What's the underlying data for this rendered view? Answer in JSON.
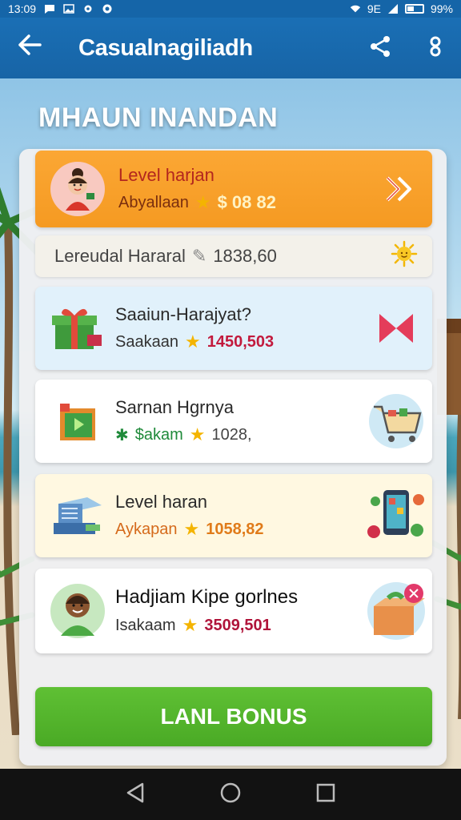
{
  "status_bar": {
    "time": "13:09",
    "network_label": "9E",
    "battery": "99%",
    "icons": [
      "message-icon",
      "image-icon",
      "settings-icon",
      "record-icon",
      "wifi-icon",
      "signal-icon",
      "battery-icon"
    ]
  },
  "app_bar": {
    "back_icon": "arrow-left-icon",
    "title": "Casualnagiliadh",
    "share_icon": "share-icon",
    "menu_icon": "more-icon"
  },
  "heading": "MHAUN INANDAN",
  "cards": {
    "top": {
      "title": "Level harjan",
      "subtitle": "Abyallaan",
      "amount": "$ 08 82",
      "avatar_icon": "girl-avatar-icon",
      "action_icon": "chevron-double-right-icon"
    },
    "info_row": {
      "label": "Lereudal Hararal",
      "amount": "1838,60",
      "badge_icon": "sun-icon"
    },
    "list": [
      {
        "title": "Saaiun-Harajyat?",
        "subtitle": "Saakaan",
        "amount": "1450,503",
        "left_icon": "gift-box-icon",
        "right_icon": "bowtie-icon"
      },
      {
        "title": "Sarnan Hgrnya",
        "subtitle": "$akam",
        "amount": "1028,",
        "left_icon": "green-box-icon",
        "right_icon": "shopping-cart-icon"
      },
      {
        "title": "Level haran",
        "subtitle": "Aykapan",
        "amount": "1058,82",
        "left_icon": "cash-register-icon",
        "right_icon": "phone-gifts-icon"
      },
      {
        "title": "Hadjiam Kipe gorlnes",
        "subtitle": "Isakaam",
        "amount": "3509,501",
        "left_icon": "boy-avatar-icon",
        "right_icon": "gift-parcel-icon"
      }
    ]
  },
  "bonus_button": "LANL BONUS",
  "nav": {
    "back": "back-triangle-icon",
    "home": "home-circle-icon",
    "recents": "recents-square-icon"
  },
  "colors": {
    "app_bar": "#1a6fb5",
    "top_card": "#f59a22",
    "bonus": "#4aaa25",
    "star": "#f4b400"
  }
}
